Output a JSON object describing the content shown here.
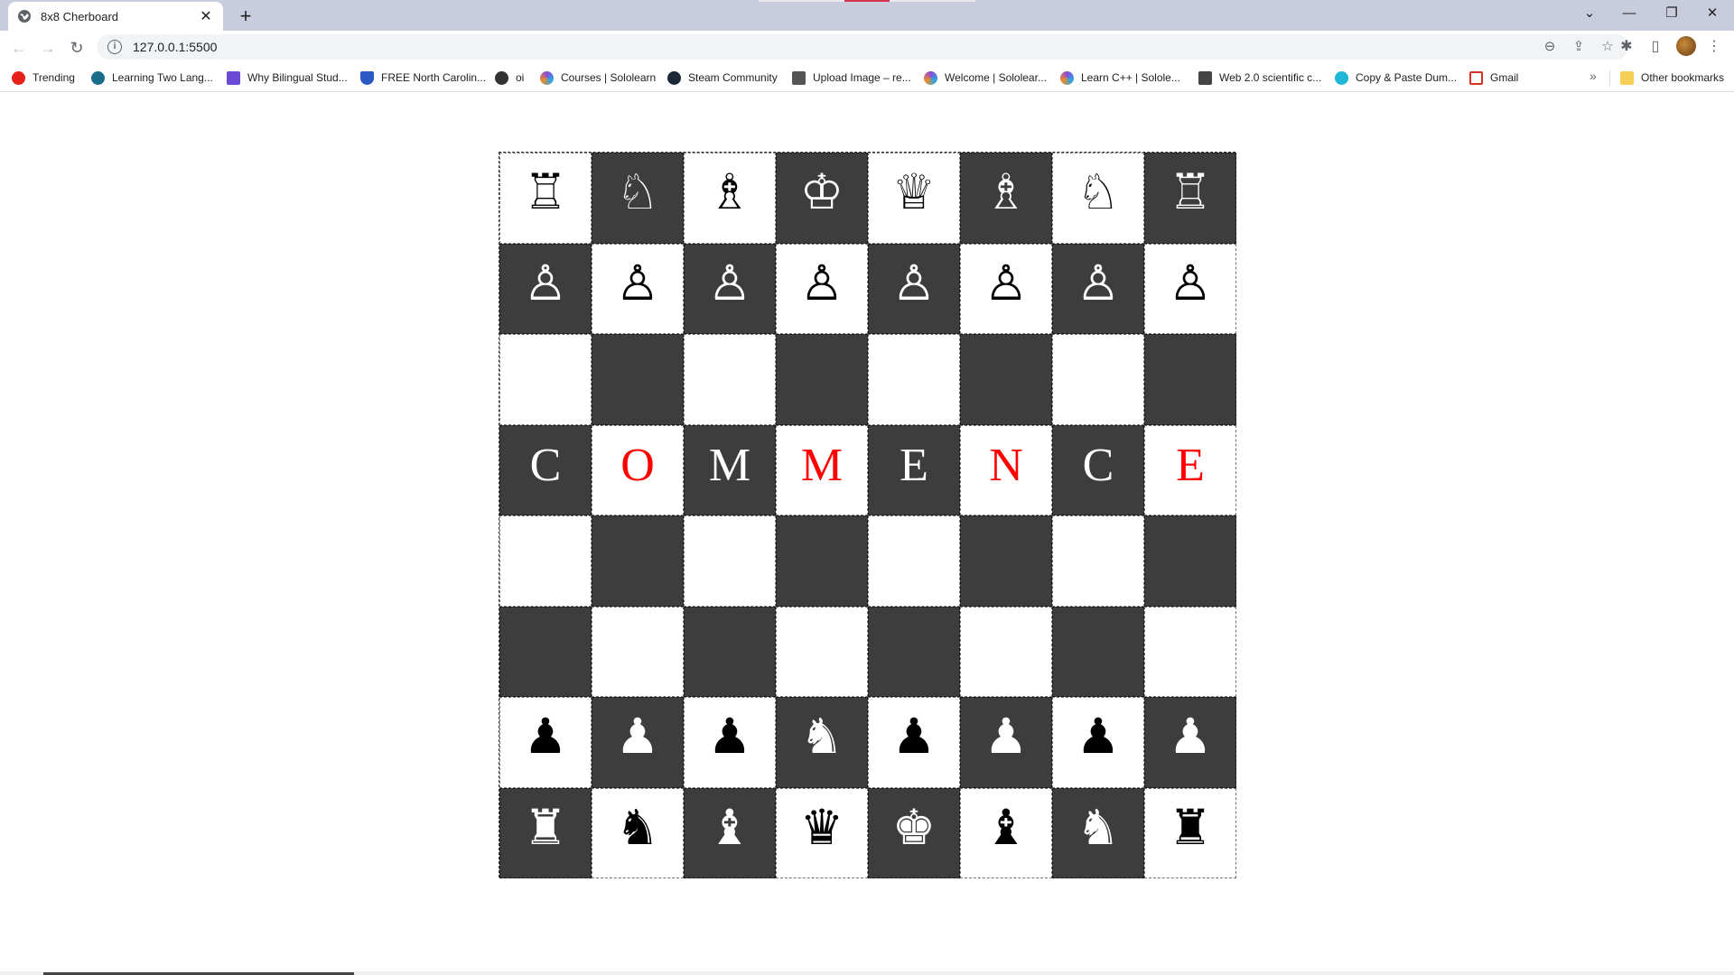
{
  "browser": {
    "tab": {
      "title": "8x8 Cherboard",
      "close": "✕",
      "favicon": "globe-icon"
    },
    "new_tab": "+",
    "window_controls": {
      "list": "⌄",
      "minimize": "—",
      "restore": "❐",
      "close": "✕"
    },
    "toolbar": {
      "back": "←",
      "forward": "→",
      "reload": "↻",
      "url": "127.0.0.1:5500",
      "info": "i",
      "zoom": "⊖",
      "share": "⇪",
      "star": "☆",
      "extensions": "✱",
      "sidepanel": "▯",
      "menu": "⋮"
    },
    "bookmarks": [
      {
        "label": "Trending",
        "icon": "youtube-icon",
        "color": "#e62117"
      },
      {
        "label": "Learning Two Lang...",
        "icon": "site-icon",
        "color": "#1a6d8a"
      },
      {
        "label": "Why Bilingual Stud...",
        "icon": "site-icon",
        "color": "#6b4bd6"
      },
      {
        "label": "FREE North Carolin...",
        "icon": "shield-icon",
        "color": "#2b59c3"
      },
      {
        "label": "oi",
        "icon": "globe-icon",
        "color": "#333333"
      },
      {
        "label": "Courses | Sololearn",
        "icon": "sololearn-icon",
        "color": "#8c4ad6"
      },
      {
        "label": "Steam Community",
        "icon": "steam-icon",
        "color": "#1b2838"
      },
      {
        "label": "Upload Image – re...",
        "icon": "site-icon",
        "color": "#555555"
      },
      {
        "label": "Welcome | Sololear...",
        "icon": "sololearn-icon",
        "color": "#8c4ad6"
      },
      {
        "label": "Learn C++ | Solole...",
        "icon": "sololearn-icon",
        "color": "#8c4ad6"
      },
      {
        "label": "Web 2.0 scientific c...",
        "icon": "calculator-icon",
        "color": "#444444"
      },
      {
        "label": "Copy & Paste Dum...",
        "icon": "site-icon",
        "color": "#1fb6d8"
      },
      {
        "label": "Gmail",
        "icon": "gmail-icon",
        "color": "#d93025"
      }
    ],
    "bookmarks_more": "»",
    "other_bookmarks": "Other bookmarks"
  },
  "board": {
    "light_color": "#ffffff",
    "dark_color": "#3d3d3d",
    "rows": [
      [
        {
          "text": "♖",
          "color": "#000000",
          "name": "white-rook"
        },
        {
          "text": "♘",
          "color": "#ffffff",
          "name": "white-knight"
        },
        {
          "text": "♗",
          "color": "#000000",
          "name": "white-bishop"
        },
        {
          "text": "♔",
          "color": "#ffffff",
          "name": "white-king"
        },
        {
          "text": "♕",
          "color": "#000000",
          "name": "white-queen"
        },
        {
          "text": "♗",
          "color": "#ffffff",
          "name": "white-bishop"
        },
        {
          "text": "♘",
          "color": "#000000",
          "name": "white-knight"
        },
        {
          "text": "♖",
          "color": "#ffffff",
          "name": "white-rook"
        }
      ],
      [
        {
          "text": "♙",
          "color": "#ffffff",
          "name": "white-pawn"
        },
        {
          "text": "♙",
          "color": "#000000",
          "name": "white-pawn"
        },
        {
          "text": "♙",
          "color": "#ffffff",
          "name": "white-pawn"
        },
        {
          "text": "♙",
          "color": "#000000",
          "name": "white-pawn"
        },
        {
          "text": "♙",
          "color": "#ffffff",
          "name": "white-pawn"
        },
        {
          "text": "♙",
          "color": "#000000",
          "name": "white-pawn"
        },
        {
          "text": "♙",
          "color": "#ffffff",
          "name": "white-pawn"
        },
        {
          "text": "♙",
          "color": "#000000",
          "name": "white-pawn"
        }
      ],
      [
        {
          "text": "",
          "color": "#000000",
          "name": "empty"
        },
        {
          "text": "",
          "color": "#000000",
          "name": "empty"
        },
        {
          "text": "",
          "color": "#000000",
          "name": "empty"
        },
        {
          "text": "",
          "color": "#000000",
          "name": "empty"
        },
        {
          "text": "",
          "color": "#000000",
          "name": "empty"
        },
        {
          "text": "",
          "color": "#000000",
          "name": "empty"
        },
        {
          "text": "",
          "color": "#000000",
          "name": "empty"
        },
        {
          "text": "",
          "color": "#000000",
          "name": "empty"
        }
      ],
      [
        {
          "text": "C",
          "color": "#ffffff",
          "name": "letter-c",
          "letter": true
        },
        {
          "text": "O",
          "color": "#ff0000",
          "name": "letter-o",
          "letter": true
        },
        {
          "text": "M",
          "color": "#ffffff",
          "name": "letter-m",
          "letter": true
        },
        {
          "text": "M",
          "color": "#ff0000",
          "name": "letter-m",
          "letter": true
        },
        {
          "text": "E",
          "color": "#ffffff",
          "name": "letter-e",
          "letter": true
        },
        {
          "text": "N",
          "color": "#ff0000",
          "name": "letter-n",
          "letter": true
        },
        {
          "text": "C",
          "color": "#ffffff",
          "name": "letter-c",
          "letter": true
        },
        {
          "text": "E",
          "color": "#ff0000",
          "name": "letter-e",
          "letter": true
        }
      ],
      [
        {
          "text": "",
          "color": "#000000",
          "name": "empty"
        },
        {
          "text": "",
          "color": "#000000",
          "name": "empty"
        },
        {
          "text": "",
          "color": "#000000",
          "name": "empty"
        },
        {
          "text": "",
          "color": "#000000",
          "name": "empty"
        },
        {
          "text": "",
          "color": "#000000",
          "name": "empty"
        },
        {
          "text": "",
          "color": "#000000",
          "name": "empty"
        },
        {
          "text": "",
          "color": "#000000",
          "name": "empty"
        },
        {
          "text": "",
          "color": "#000000",
          "name": "empty"
        }
      ],
      [
        {
          "text": "",
          "color": "#000000",
          "name": "empty"
        },
        {
          "text": "",
          "color": "#000000",
          "name": "empty"
        },
        {
          "text": "",
          "color": "#000000",
          "name": "empty"
        },
        {
          "text": "",
          "color": "#000000",
          "name": "empty"
        },
        {
          "text": "",
          "color": "#000000",
          "name": "empty"
        },
        {
          "text": "",
          "color": "#000000",
          "name": "empty"
        },
        {
          "text": "",
          "color": "#000000",
          "name": "empty"
        },
        {
          "text": "",
          "color": "#000000",
          "name": "empty"
        }
      ],
      [
        {
          "text": "♟",
          "color": "#000000",
          "name": "black-pawn"
        },
        {
          "text": "♟",
          "color": "#ffffff",
          "name": "black-pawn"
        },
        {
          "text": "♟",
          "color": "#000000",
          "name": "black-pawn"
        },
        {
          "text": "♞",
          "color": "#ffffff",
          "name": "black-knight"
        },
        {
          "text": "♟",
          "color": "#000000",
          "name": "black-pawn"
        },
        {
          "text": "♟",
          "color": "#ffffff",
          "name": "black-pawn"
        },
        {
          "text": "♟",
          "color": "#000000",
          "name": "black-pawn"
        },
        {
          "text": "♟",
          "color": "#ffffff",
          "name": "black-pawn"
        }
      ],
      [
        {
          "text": "♜",
          "color": "#ffffff",
          "name": "black-rook"
        },
        {
          "text": "♞",
          "color": "#000000",
          "name": "black-knight"
        },
        {
          "text": "♝",
          "color": "#ffffff",
          "name": "black-bishop"
        },
        {
          "text": "♛",
          "color": "#000000",
          "name": "black-queen"
        },
        {
          "text": "♚",
          "color": "#ffffff",
          "name": "black-king"
        },
        {
          "text": "♝",
          "color": "#000000",
          "name": "black-bishop"
        },
        {
          "text": "♞",
          "color": "#ffffff",
          "name": "black-knight"
        },
        {
          "text": "♜",
          "color": "#000000",
          "name": "black-rook"
        }
      ]
    ]
  }
}
